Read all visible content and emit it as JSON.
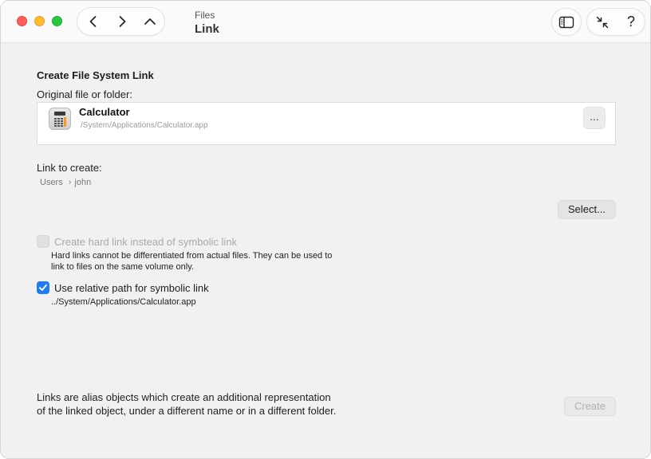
{
  "window": {
    "subtitle": "Files",
    "title": "Link"
  },
  "colors": {
    "accent": "#1f7cf5",
    "close": "#ff5f57",
    "minimize": "#febc2e",
    "zoom": "#28c840"
  },
  "toolbar": {
    "icons": [
      "chevron-left-icon",
      "chevron-right-icon",
      "chevron-up-icon",
      "sidebar-icon",
      "collapse-icon",
      "help-icon"
    ],
    "help_glyph": "?"
  },
  "form": {
    "section_title": "Create File System Link",
    "original_label": "Original file or folder:",
    "original": {
      "name": "Calculator",
      "path": "/System/Applications/Calculator.app",
      "more_label": "..."
    },
    "link_label": "Link to create:",
    "link_path": [
      "Users",
      "john"
    ],
    "select_button": "Select...",
    "hard_link": {
      "label": "Create hard link instead of symbolic link",
      "checked": false,
      "enabled": false,
      "note_line1": "Hard links cannot be differentiated from actual files. They can be used to",
      "note_line2": "link to files on the same volume only."
    },
    "relative_path": {
      "label": "Use relative path for symbolic link",
      "checked": true,
      "value": "../System/Applications/Calculator.app"
    }
  },
  "footer": {
    "line1": "Links are alias objects which create an additional representation",
    "line2": "of the linked object, under a different name or in a different folder.",
    "create_button": "Create"
  }
}
